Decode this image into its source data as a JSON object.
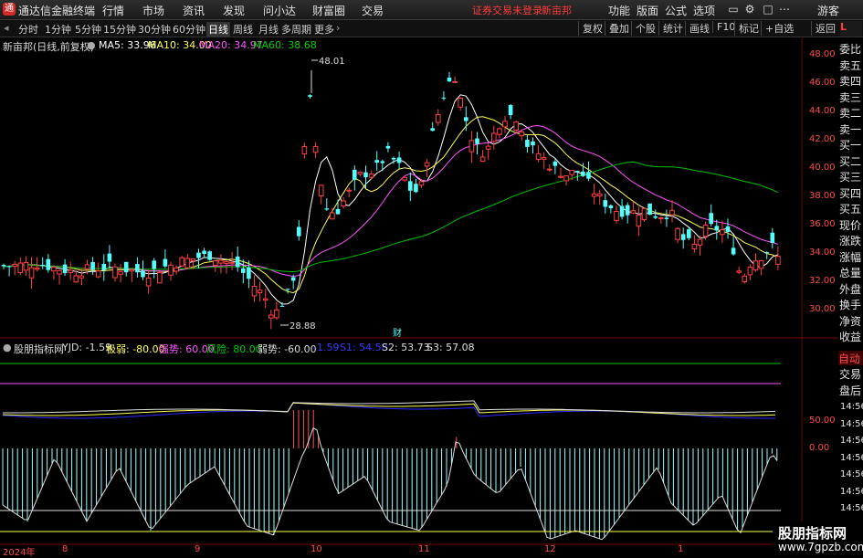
{
  "titlebar": {
    "app_name": "通达信金融终端",
    "menus": [
      "行情",
      "市场",
      "资讯",
      "发现",
      "问小达",
      "财富圈",
      "交易"
    ],
    "warning": "证券交易未登录",
    "stock": "新亩邦",
    "right_menus": [
      "功能",
      "版面",
      "公式",
      "选项"
    ],
    "guest": "游客"
  },
  "toolbar": {
    "periods": [
      "分时",
      "1分钟",
      "5分钟",
      "15分钟",
      "30分钟",
      "60分钟",
      "日线",
      "周线",
      "月线",
      "多周期",
      "更多"
    ],
    "active": "日线",
    "right_buttons": [
      "复权",
      "叠加",
      "个股",
      "统计",
      "画线",
      "F10",
      "标记",
      "+自选",
      "返回"
    ]
  },
  "main_info": {
    "name": "新亩邦(日线,前复权)",
    "ma5": "MA5: 33.96",
    "ma10": "MA10: 34.00",
    "ma20": "MA20: 34.97",
    "ma60": "MA60: 38.68",
    "high_label": "48.01",
    "low_label": "28.88",
    "cai": "财"
  },
  "indicator_info": {
    "name": "股朋指标网",
    "yjd": "YJD: -1.59",
    "jiruo": "极弱: -80.00",
    "qiangshi": "强势: 60.00",
    "fengxian": "风险: 80.00",
    "ruoshi": "弱势: -60.00",
    "s1": "-1.59",
    "s1b": "S1: 54.58",
    "s2": "S2: 53.73",
    "s3": "S3: 57.08"
  },
  "price_axis": [
    "48.00",
    "46.00",
    "44.00",
    "42.00",
    "40.00",
    "38.00",
    "36.00",
    "34.00",
    "32.00",
    "30.00"
  ],
  "ind_axis": [
    "50.00",
    "0.00"
  ],
  "x_axis": [
    "2024年",
    "8",
    "9",
    "10",
    "11",
    "12",
    "1"
  ],
  "side_panel": {
    "header": "L",
    "items": [
      "委比",
      "卖五",
      "卖四",
      "卖三",
      "卖二",
      "卖一",
      "买一",
      "买二",
      "买三",
      "买四",
      "买五",
      "现价",
      "涨跌",
      "涨幅",
      "总量",
      "外盘",
      "换手",
      "净资",
      "收益"
    ],
    "bottom_tabs": [
      "自动",
      "交易",
      "盘后"
    ],
    "times": [
      "14:56",
      "14:56",
      "14:56",
      "14:56",
      "14:56",
      "14:56",
      "14:56",
      "14:56"
    ]
  },
  "watermark": {
    "line1": "股朋指标网",
    "line2": "www.7gpzb.com"
  },
  "colors": {
    "up": "#ff4040",
    "down": "#54ffff",
    "ma5": "#ffffff",
    "ma10": "#ffff54",
    "ma20": "#ff54ff",
    "ma60": "#00c000"
  }
}
